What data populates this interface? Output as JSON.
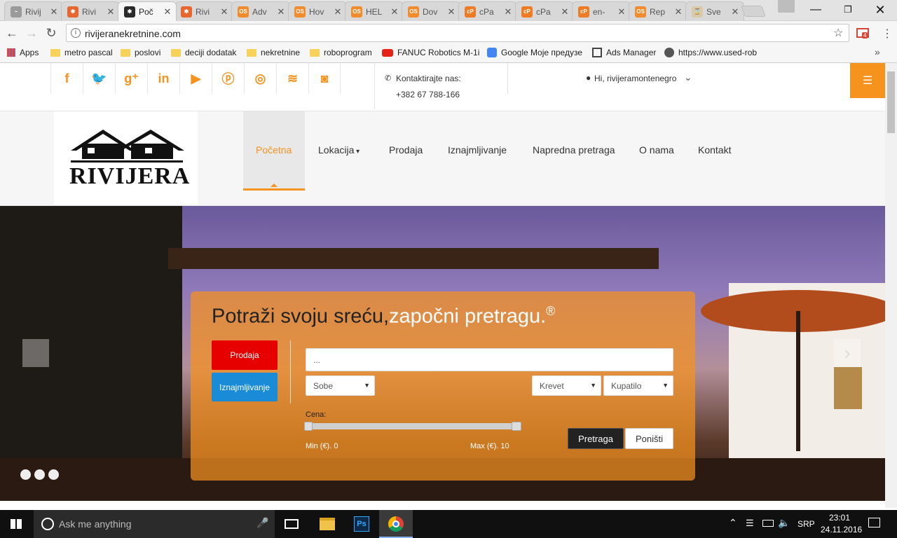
{
  "browser": {
    "tabs": [
      {
        "title": "Rivij",
        "fav_color": "#9a9a9a",
        "fav_glyph": "~"
      },
      {
        "title": "Rivi",
        "fav_color": "#e8662f",
        "fav_glyph": "✱"
      },
      {
        "title": "Poč",
        "fav_color": "#2a2a2a",
        "fav_glyph": "✱"
      },
      {
        "title": "Rivi",
        "fav_color": "#e8662f",
        "fav_glyph": "✱"
      },
      {
        "title": "Adv",
        "fav_color": "#f28b2c",
        "fav_glyph": "OS"
      },
      {
        "title": "Hov",
        "fav_color": "#f28b2c",
        "fav_glyph": "OS"
      },
      {
        "title": "HEL",
        "fav_color": "#f28b2c",
        "fav_glyph": "OS"
      },
      {
        "title": "Dov",
        "fav_color": "#f28b2c",
        "fav_glyph": "OS"
      },
      {
        "title": "cPa",
        "fav_color": "#f07b25",
        "fav_glyph": "cP"
      },
      {
        "title": "cPa",
        "fav_color": "#f07b25",
        "fav_glyph": "cP"
      },
      {
        "title": "en-",
        "fav_color": "#f07b25",
        "fav_glyph": "cP"
      },
      {
        "title": "Rep",
        "fav_color": "#f28b2c",
        "fav_glyph": "OS"
      },
      {
        "title": "Sve",
        "fav_color": "#d8c9a8",
        "fav_glyph": "⌛"
      }
    ],
    "active_tab": 2,
    "url": "rivijeranekretnine.com",
    "gmail_badge": "4",
    "bookmarks": [
      {
        "label": "Apps",
        "type": "apps"
      },
      {
        "label": "metro pascal",
        "type": "folder"
      },
      {
        "label": "poslovi",
        "type": "folder"
      },
      {
        "label": "deciji dodatak",
        "type": "folder"
      },
      {
        "label": "nekretnine",
        "type": "folder"
      },
      {
        "label": "roboprogram",
        "type": "folder"
      },
      {
        "label": "FANUC Robotics M-1i",
        "type": "youtube"
      },
      {
        "label": "Google Moje предузе",
        "type": "google"
      },
      {
        "label": "Ads Manager",
        "type": "ads"
      },
      {
        "label": "https://www.used-rob",
        "type": "globe"
      }
    ],
    "bookmarks_more": "»"
  },
  "site": {
    "social_icons": [
      "f",
      "t",
      "g+",
      "in",
      "yt",
      "p",
      "dribbble",
      "rss",
      "ig"
    ],
    "contact_label": "Kontaktirajte nas:",
    "contact_phone": "+382 67 788-166",
    "user_greeting": "Hi, rivijeramontenegro",
    "logo_text": "RIVIJERA",
    "nav": [
      {
        "label": "Početna",
        "active": true
      },
      {
        "label": "Lokacija",
        "dropdown": true
      },
      {
        "label": "Prodaja"
      },
      {
        "label": "Iznajmljivanje"
      },
      {
        "label": "Napredna pretraga"
      },
      {
        "label": "O nama"
      },
      {
        "label": "Kontakt"
      }
    ],
    "accent": "#f6921e"
  },
  "search": {
    "title_main": "Potraži svoju sreću,",
    "title_accent": "započni pretragu.",
    "title_sup": "®",
    "sale_button": "Prodaja",
    "rent_button": "Iznajmljivanje",
    "keyword_placeholder": "...",
    "rooms_select": "Sobe",
    "beds_select": "Krevet",
    "baths_select": "Kupatilo",
    "price_label": "Cena:",
    "min_label": "Min (€). 0",
    "max_label": "Max (€). 10",
    "search_button": "Pretraga",
    "reset_button": "Poništi"
  },
  "slider": {
    "dots": 3,
    "next": "›"
  },
  "taskbar": {
    "search_placeholder": "Ask me anything",
    "lang": "SRP",
    "time": "23:01",
    "date": "24.11.2016"
  }
}
